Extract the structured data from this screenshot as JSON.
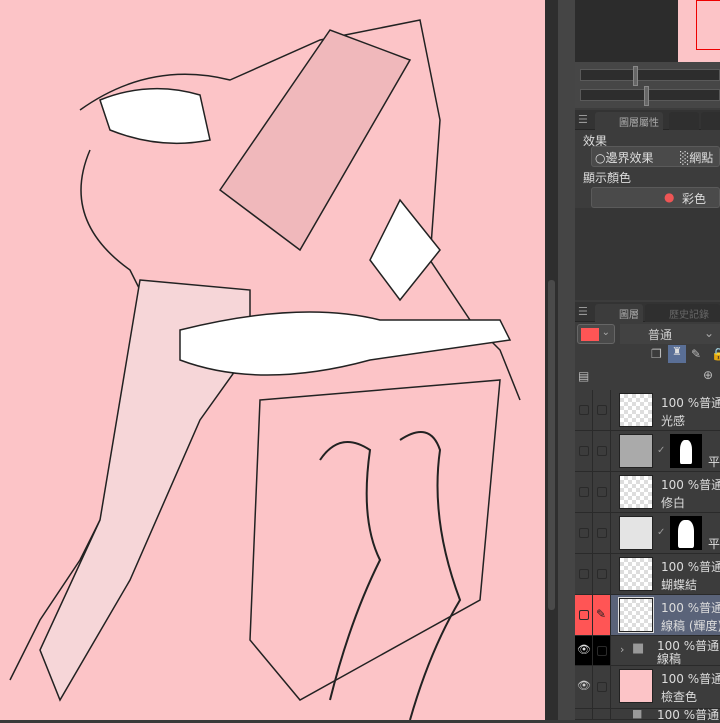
{
  "navigator": {
    "sliders": [
      {
        "name": "zoom",
        "value": 0.42
      },
      {
        "name": "rotate",
        "value": 0.5
      }
    ]
  },
  "properties": {
    "tab_label": "圖層屬性",
    "effect_header": "效果",
    "border_effect": "邊界效果",
    "halftone": "網點",
    "display_color_header": "顯示顏色",
    "color_mode": "彩色"
  },
  "layers_panel": {
    "tab_label": "圖層",
    "history_tab": "歷史記錄",
    "blend_mode": "普通",
    "current_color": "#ff5555",
    "layers": [
      {
        "opacity": "100 %普通",
        "name": "光感",
        "type": "raster"
      },
      {
        "name": "平",
        "type": "adjustment"
      },
      {
        "opacity": "100 %普通",
        "name": "修白",
        "type": "raster"
      },
      {
        "name": "平",
        "type": "adjustment"
      },
      {
        "opacity": "100 %普通",
        "name": "蝴蝶結",
        "type": "raster"
      },
      {
        "opacity": "100 %普通",
        "name": "線稿 (輝度)",
        "type": "raster",
        "selected": true
      },
      {
        "opacity": "100 %普通",
        "name": "線稿",
        "type": "folder",
        "visible": true
      },
      {
        "opacity": "100 %普通",
        "name": "檢查色",
        "type": "raster",
        "visible": true
      },
      {
        "opacity": "100 %普通",
        "name": "",
        "type": "folder"
      }
    ]
  },
  "colors": {
    "canvas": "#fcc4c7",
    "accent": "#ff5555",
    "selected_row": "#5a6379"
  }
}
